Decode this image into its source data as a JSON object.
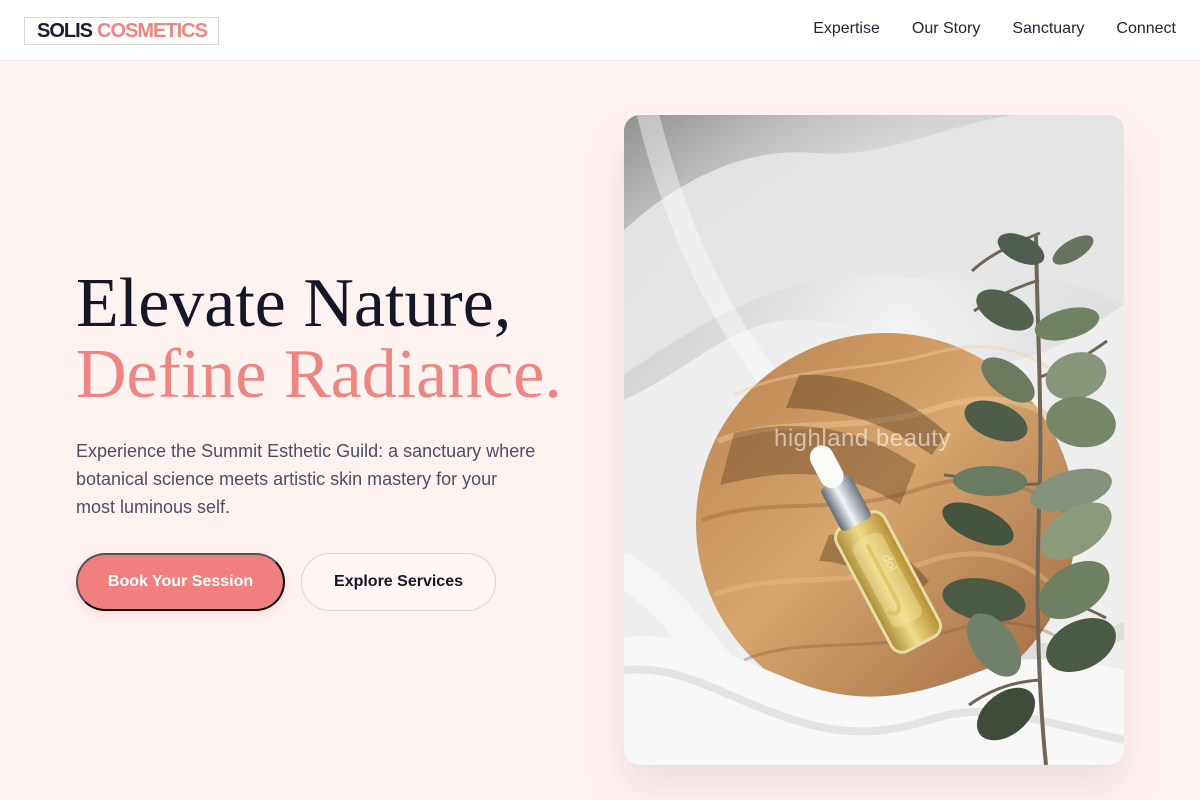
{
  "brand": {
    "primary": "SOLIS",
    "accent": "COSMETICS",
    "colors": {
      "dark": "#1a1d2e",
      "accent": "#ee8580",
      "background": "#fff3f2"
    }
  },
  "nav": {
    "items": [
      {
        "label": "Expertise"
      },
      {
        "label": "Our Story"
      },
      {
        "label": "Sanctuary"
      },
      {
        "label": "Connect"
      }
    ]
  },
  "hero": {
    "title_line_1": "Elevate Nature,",
    "title_line_2": "Define Radiance.",
    "description": "Experience the Summit Esthetic Guild: a sanctuary where botanical science meets artistic skin mastery for your most luminous self.",
    "primary_button": "Book Your Session",
    "secondary_button": "Explore Services"
  },
  "image": {
    "watermark": "highland beauty",
    "bottle_label": "dol"
  }
}
